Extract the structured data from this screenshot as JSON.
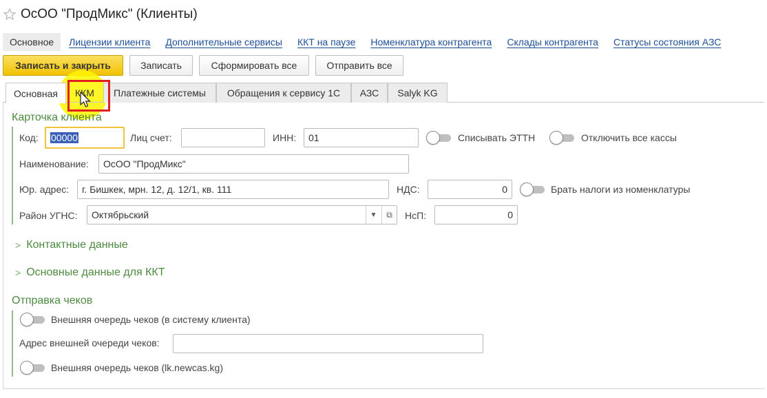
{
  "window": {
    "title": "ОсОО \"ПродМикс\" (Клиенты)"
  },
  "nav": {
    "items": [
      "Основное",
      "Лицензии клиента",
      "Дополнительные сервисы",
      "ККТ на паузе",
      "Номенклатура контрагента",
      "Склады контрагента",
      "Статусы состояния АЗС"
    ]
  },
  "toolbar": {
    "save_close": "Записать и закрыть",
    "save": "Записать",
    "generate_all": "Сформировать все",
    "send_all": "Отправить все"
  },
  "tabs": [
    "Основная",
    "ККМ",
    "Платежные системы",
    "Обращения к сервису 1С",
    "АЗС",
    "Salyk KG"
  ],
  "card": {
    "title": "Карточка клиента",
    "code_label": "Код:",
    "code_value": "00000",
    "account_label": "Лиц счет:",
    "account_value": "",
    "inn_label": "ИНН:",
    "inn_value": "01",
    "write_off_label": "Списывать ЭТТН",
    "disable_all_label": "Отключить все кассы",
    "name_label": "Наименование:",
    "name_value": "ОсОО \"ПродМикс\"",
    "address_label": "Юр. адрес:",
    "address_value": "г. Бишкек, мрн. 12, д. 12/1, кв. 111",
    "vat_label": "НДС:",
    "vat_value": "0",
    "taxes_label": "Брать налоги из номенклатуры",
    "district_label": "Район УГНС:",
    "district_value": "Октябрьский",
    "nsp_label": "НсП:",
    "nsp_value": "0"
  },
  "sections": {
    "contacts": "Контактные данные",
    "kkt_data": "Основные данные для ККТ"
  },
  "receipts": {
    "title": "Отправка чеков",
    "external_queue_label": "Внешняя очередь чеков (в систему клиента)",
    "queue_address_label": "Адрес внешней очереди чеков:",
    "queue_address_value": "",
    "newcas_queue_label": "Внешняя очередь чеков (lk.newcas.kg)"
  },
  "colors": {
    "accent_green": "#4c8a3f",
    "link_blue": "#1c4e9a",
    "primary_button": "#f2c200",
    "highlight_red": "#e02020"
  },
  "icons": {
    "star": "star-icon",
    "chevron": "chevron-right-icon",
    "dropdown": "chevron-down-icon",
    "open": "open-form-icon",
    "cursor": "mouse-pointer-icon"
  }
}
